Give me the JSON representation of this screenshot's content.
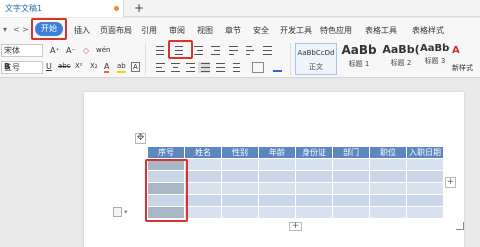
{
  "tab": {
    "title": "文字文稿1",
    "new_tab": "+"
  },
  "menu": {
    "left_controls": [
      "▾",
      "<",
      ">"
    ],
    "start": "开始",
    "items": [
      "插入",
      "页面布局",
      "引用",
      "审阅",
      "视图",
      "章节",
      "安全",
      "开发工具",
      "特色应用",
      "表格工具",
      "表格样式"
    ]
  },
  "ribbon": {
    "font_name": "宋体",
    "font_size": "五号",
    "grow_font": "A⁺",
    "shrink_font": "A⁻",
    "clear_format": "◇",
    "change_case": "wén",
    "bold": "B",
    "italic": "I",
    "underline": "U",
    "strike": "abc",
    "superscript": "X²",
    "subscript": "X₂",
    "font_color": "A",
    "highlight": "ab",
    "char_border": "A",
    "char_shade": "A",
    "styles": [
      {
        "sample": "AaBbCcDd",
        "name": "正文"
      },
      {
        "sample": "AaBb",
        "name": "标题 1"
      },
      {
        "sample": "AaBb(",
        "name": "标题 2"
      },
      {
        "sample": "AaBbC",
        "name": "标题 3"
      }
    ],
    "new_style": "新样式"
  },
  "table": {
    "headers": [
      "序号",
      "姓名",
      "性别",
      "年龄",
      "身份证",
      "部门",
      "职位",
      "入职日期"
    ],
    "rows": [
      [
        "",
        "",
        "",
        "",
        "",
        "",
        "",
        ""
      ],
      [
        "",
        "",
        "",
        "",
        "",
        "",
        "",
        ""
      ],
      [
        "",
        "",
        "",
        "",
        "",
        "",
        "",
        ""
      ],
      [
        "",
        "",
        "",
        "",
        "",
        "",
        "",
        ""
      ],
      [
        "",
        "",
        "",
        "",
        "",
        "",
        "",
        ""
      ]
    ]
  },
  "controls": {
    "move_handle": "✥",
    "add_column": "+",
    "add_row": "+"
  },
  "colors": {
    "accent": "#3c80d8",
    "highlight_box": "#d9342b",
    "table_header": "#5d87bf",
    "table_cell": "#d8e1ee",
    "selected_cell": "#a9b6c6"
  }
}
